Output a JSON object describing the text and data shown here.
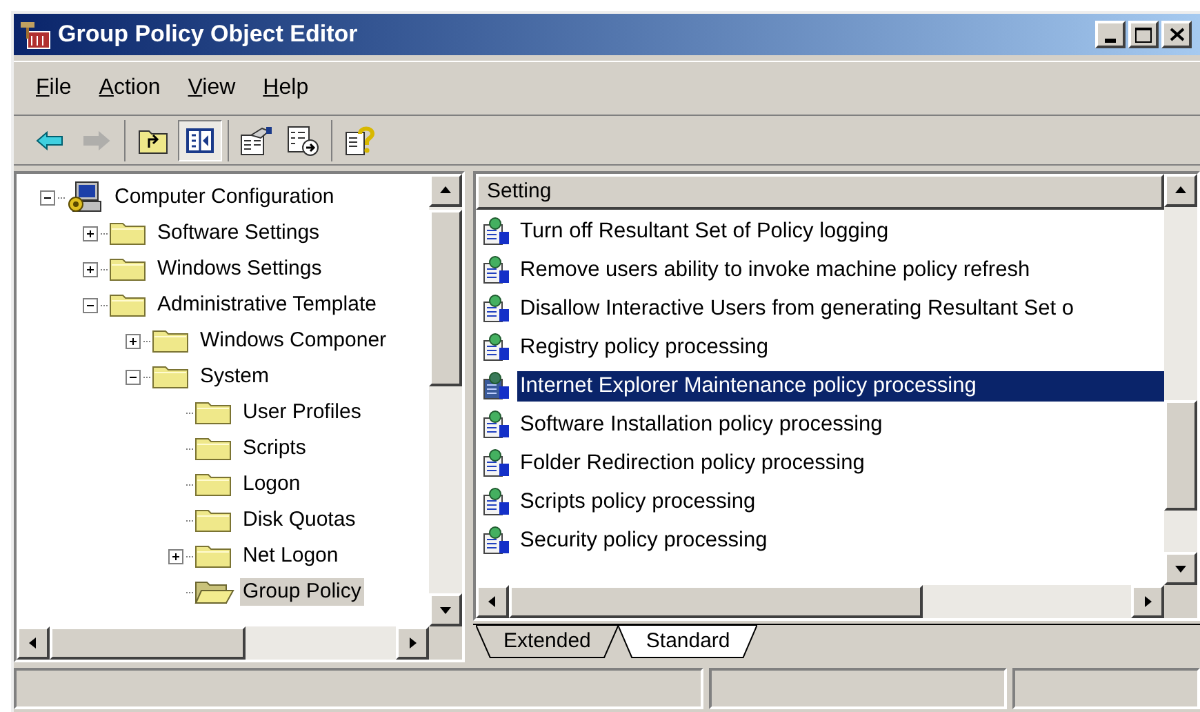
{
  "window": {
    "title": "Group Policy Object Editor"
  },
  "menu": [
    {
      "key": "F",
      "rest": "ile"
    },
    {
      "key": "A",
      "rest": "ction"
    },
    {
      "key": "V",
      "rest": "iew"
    },
    {
      "key": "H",
      "rest": "elp"
    }
  ],
  "toolbar": [
    [
      {
        "kind": "back",
        "disabled": false,
        "pressed": false
      },
      {
        "kind": "forward",
        "disabled": true,
        "pressed": false
      }
    ],
    [
      {
        "kind": "up",
        "disabled": false,
        "pressed": false
      },
      {
        "kind": "tree",
        "disabled": false,
        "pressed": true
      }
    ],
    [
      {
        "kind": "properties",
        "disabled": false,
        "pressed": false
      },
      {
        "kind": "export",
        "disabled": false,
        "pressed": false
      }
    ],
    [
      {
        "kind": "help",
        "disabled": false,
        "pressed": false
      }
    ]
  ],
  "tree": [
    {
      "label": "Computer Configuration",
      "kind": "computer",
      "expanded": true,
      "selected": false,
      "children": [
        {
          "label": "Software Settings",
          "kind": "folder",
          "expanded": false,
          "selected": false
        },
        {
          "label": "Windows Settings",
          "kind": "folder",
          "expanded": false,
          "selected": false
        },
        {
          "label": "Administrative Template",
          "kind": "folder",
          "expanded": true,
          "selected": false,
          "children": [
            {
              "label": "Windows Componer",
              "kind": "folder",
              "expanded": false,
              "selected": false
            },
            {
              "label": "System",
              "kind": "folder",
              "expanded": true,
              "selected": false,
              "children": [
                {
                  "label": "User Profiles",
                  "kind": "folder",
                  "selected": false
                },
                {
                  "label": "Scripts",
                  "kind": "folder",
                  "selected": false
                },
                {
                  "label": "Logon",
                  "kind": "folder",
                  "selected": false
                },
                {
                  "label": "Disk Quotas",
                  "kind": "folder",
                  "selected": false
                },
                {
                  "label": "Net Logon",
                  "kind": "folder",
                  "expanded": false,
                  "selected": false
                },
                {
                  "label": "Group Policy",
                  "kind": "folder",
                  "selected": true
                }
              ]
            }
          ]
        }
      ]
    }
  ],
  "list": {
    "column": "Setting",
    "rows": [
      {
        "label": "Turn off Resultant Set of Policy logging",
        "selected": false
      },
      {
        "label": "Remove users ability to invoke machine policy refresh",
        "selected": false
      },
      {
        "label": "Disallow Interactive Users from generating Resultant Set o",
        "selected": false
      },
      {
        "label": "Registry policy processing",
        "selected": false
      },
      {
        "label": "Internet Explorer Maintenance policy processing",
        "selected": true
      },
      {
        "label": "Software Installation policy processing",
        "selected": false
      },
      {
        "label": "Folder Redirection policy processing",
        "selected": false
      },
      {
        "label": "Scripts policy processing",
        "selected": false
      },
      {
        "label": "Security policy processing",
        "selected": false
      }
    ]
  },
  "tabs": [
    {
      "label": "Extended",
      "selected": false
    },
    {
      "label": "Standard",
      "selected": true
    }
  ]
}
